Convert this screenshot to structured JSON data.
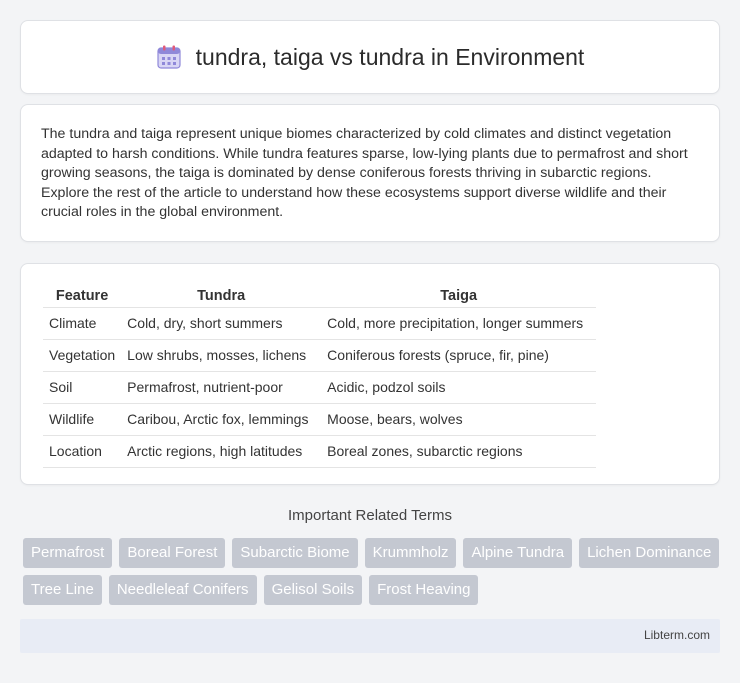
{
  "header": {
    "icon": "calendar-icon",
    "title": "tundra, taiga vs tundra in Environment"
  },
  "intro": {
    "text": "The tundra and taiga represent unique biomes characterized by cold climates and distinct vegetation adapted to harsh conditions. While tundra features sparse, low-lying plants due to permafrost and short growing seasons, the taiga is dominated by dense coniferous forests thriving in subarctic regions. Explore the rest of the article to understand how these ecosystems support diverse wildlife and their crucial roles in the global environment."
  },
  "table": {
    "headers": [
      "Feature",
      "Tundra",
      "Taiga"
    ],
    "rows": [
      [
        "Climate",
        "Cold, dry, short summers",
        "Cold, more precipitation, longer summers"
      ],
      [
        "Vegetation",
        "Low shrubs, mosses, lichens",
        "Coniferous forests (spruce, fir, pine)"
      ],
      [
        "Soil",
        "Permafrost, nutrient-poor",
        "Acidic, podzol soils"
      ],
      [
        "Wildlife",
        "Caribou, Arctic fox, lemmings",
        "Moose, bears, wolves"
      ],
      [
        "Location",
        "Arctic regions, high latitudes",
        "Boreal zones, subarctic regions"
      ]
    ]
  },
  "related": {
    "title": "Important Related Terms",
    "tags": [
      "Permafrost",
      "Boreal Forest",
      "Subarctic Biome",
      "Krummholz",
      "Alpine Tundra",
      "Lichen Dominance",
      "Tree Line",
      "Needleleaf Conifers",
      "Gelisol Soils",
      "Frost Heaving"
    ]
  },
  "footer": {
    "site": "Libterm.com"
  },
  "colors": {
    "tag_bg": "#c4c8d1",
    "footer_bg": "#e8ecf5",
    "page_bg": "#f3f4f6"
  }
}
